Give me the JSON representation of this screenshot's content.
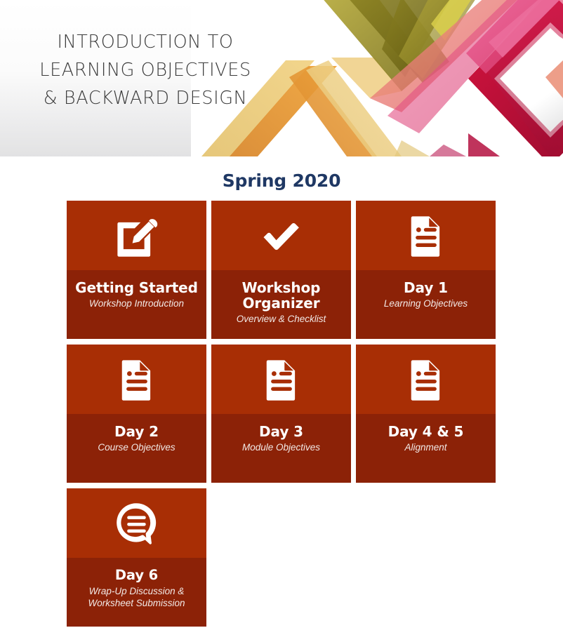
{
  "banner": {
    "title": "INTRODUCTION TO\nLEARNING OBJECTIVES\n& BACKWARD DESIGN",
    "art_name": "abstract-chevron-diamond-graphic",
    "colors": {
      "olive": "#6b6416",
      "gold": "#efc25c",
      "orange": "#e8922f",
      "crimson": "#c3103c",
      "pink": "#e0507c",
      "salmon": "#e87f79",
      "background_top": "#ffffff",
      "background_bottom": "#e2e2e3"
    }
  },
  "main": {
    "term_heading": "Spring 2020",
    "accent_color": "#1f3864",
    "card_icon_color": "#a82e05",
    "card_label_color": "#8c2207",
    "cards": [
      {
        "title": "Getting Started",
        "subtitle": "Workshop Introduction",
        "icon": "edit-square-icon"
      },
      {
        "title": "Workshop\nOrganizer",
        "subtitle": "Overview & Checklist",
        "icon": "checkmark-icon"
      },
      {
        "title": "Day 1",
        "subtitle": "Learning Objectives",
        "icon": "document-icon"
      },
      {
        "title": "Day 2",
        "subtitle": "Course Objectives",
        "icon": "document-icon"
      },
      {
        "title": "Day 3",
        "subtitle": "Module Objectives",
        "icon": "document-icon"
      },
      {
        "title": "Day 4 & 5",
        "subtitle": "Alignment",
        "icon": "document-icon"
      },
      {
        "title": "Day 6",
        "subtitle": "Wrap-Up Discussion &\nWorksheet Submission",
        "icon": "discussion-bubble-icon"
      }
    ]
  }
}
